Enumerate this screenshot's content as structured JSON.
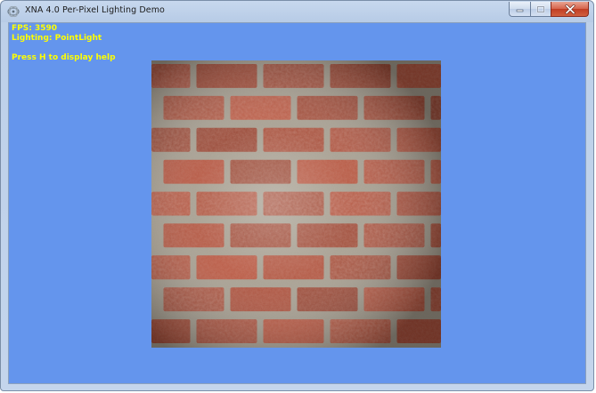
{
  "window": {
    "title": "XNA 4.0 Per-Pixel Lighting Demo",
    "icon": "xna-app-icon",
    "controls": [
      "minimize-icon",
      "maximize-icon",
      "close-icon"
    ]
  },
  "hud": {
    "fps": "FPS: 3590",
    "lighting": "Lighting: PointLight",
    "help_hint": "Press H to display help",
    "text_color": "#ffff00"
  },
  "scene": {
    "background_color": "#6495ed",
    "object": "brick-wall-quad",
    "mortar_color": "#a8a090",
    "brick_color": "#a4402a"
  }
}
